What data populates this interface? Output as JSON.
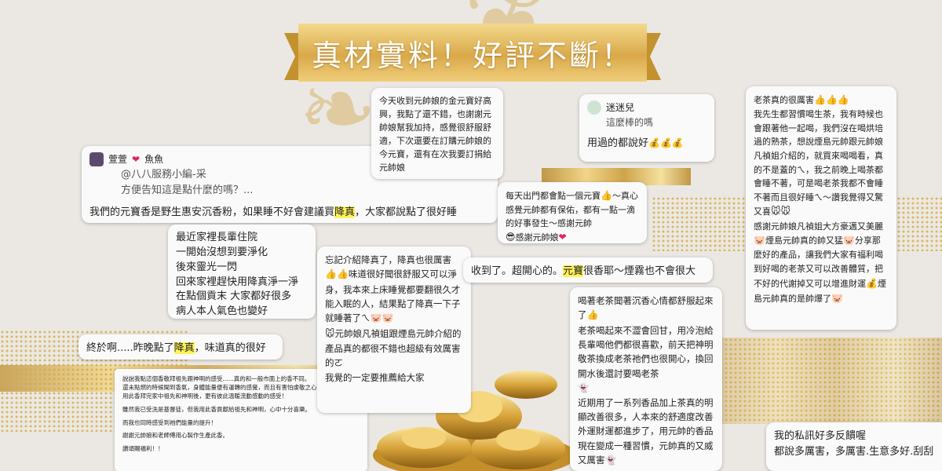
{
  "banner": {
    "title": "真材實料！好評不斷！"
  },
  "colors": {
    "background": "#ebe8e4",
    "gold": "#d9a94a",
    "highlight": "#fff35a"
  },
  "card1": {
    "name": "萱萱",
    "name_suffix": "魚魚",
    "heart_icon": "❤",
    "reply_to": "@八八服務小編-采",
    "quote": "方便告知這是點什麼的嗎？...",
    "msg_before": "我們的元寶香是野生惠安沉香粉，如果睡不好會建議買",
    "msg_highlight": "降真",
    "msg_after": "，大家都說點了很好睡"
  },
  "card2": {
    "lines": [
      "最近家裡長輩住院",
      "一開始沒想到要淨化",
      "後來靈光一閃",
      "回來家裡趕快用降真淨一淨",
      "在點個貢末 大家都好很多",
      "病人本人氣色也變好"
    ]
  },
  "card3": {
    "text_before": "終於啊.....昨晚點了",
    "highlight": "降真",
    "text_after": "，味道真的很好"
  },
  "card4": {
    "lines": [
      "說說我點這個香敬拜祖先跟神明的感受......真的和一般市面上的香不同。",
      "還未點燃的時候聞到香氣，身體能量便有運轉的感覺，而且有害怕虔敬之心油然升起！",
      "用此香拜完家中祖先和神明後，更有彼此溫暖流動感動的感受！",
      "",
      "雖然我已受洗是基督徒，但我用此香貢獻給祖先和神明，心中十分喜樂。",
      "",
      "而我也同時感受到祂們能量的提升！",
      "",
      "謝謝元帥娘和老師傅用心製作生產此香。",
      "",
      "讚頌賜福利！！"
    ]
  },
  "card5": {
    "text": "今天收到元帥娘的金元寶好高興，我點了還不錯，也謝謝元帥娘幫我加持，感覺很舒服舒適，下次還要在訂購元帥娘的今元寶，還有在次我要訂捐給元帥娘"
  },
  "card6": {
    "line1": "忘記介紹降真了，降真也很厲害",
    "text": "味道很好聞很舒服又可以淨身，我本來上床睡覺都要翻很久才能入眠的人，結果點了降真一下子就睡著了ㄟ",
    "text2": "元帥娘凡禎姐跟煙島元帥介紹的產品真的都很不錯也超級有效厲害的ㄛ",
    "text3": "我覺的一定要推薦給大家"
  },
  "card7": {
    "text_before": "收到了。超開心的。",
    "highlight": "元寶",
    "text_after": "很香耶～煙霧也不會很大"
  },
  "card8": {
    "name": "迷迷兒",
    "quote": "這麼棒的嗎",
    "msg": "用過的都說好"
  },
  "card9": {
    "text": "每天出門都會點一個元寶",
    "text2": "～真心感覺元帥都有保佑，都有一點一滴的好事發生～感謝元帥",
    "text3": "感謝元帥娘"
  },
  "card10": {
    "line1": "喝著老茶聞著沉香心情都舒服起來了",
    "text": "老茶喝起來不澀會回甘，用冷泡給長輩喝他們都很喜歡，前天把神明敬茶換成老茶祂們也很開心，換回開水後還討要喝老茶",
    "text2": "近期用了一系列香品加上茶真的明顯改善很多，人本來的舒適度改善外運財運都進步了，用元帥的香品現在變成一種習慣，元帥真的又威又厲害"
  },
  "card11": {
    "line1": "老茶真的很厲害",
    "text": "我先生都習慣喝生茶，我有時候也會跟著他一起喝，我們沒在喝烘培過的熟茶，想說煙島元帥跟元帥娘凡禎姐介紹的，就買來喝喝看，真的不是蓋的ㄟ，我之前晚上喝茶都會睡不著，可是喝老茶我都不會睡不著而且很好睡ㄟ～讚我覺得又驚又喜",
    "text2": "感謝元帥娘凡禎姐大方豪邁又美麗",
    "text3": "煙島元帥真的帥又猛",
    "text4": "分享那麼好的產品，讓我們大家有福利喝到好喝的老茶又可以改善體質，把不好的代謝掉又可以增進財運",
    "text5": "煙島元帥真的是帥爆了"
  },
  "card12": {
    "line1": "我的私訊好多反饋喔",
    "line2": "都說多厲害，多厲害.生意多好.刮刮"
  },
  "icons": {
    "thumbs": "👍",
    "heart": "❤",
    "money": "💰",
    "mouse": "🐭",
    "pig": "🐷",
    "ghost": "👻",
    "face": "😎"
  }
}
